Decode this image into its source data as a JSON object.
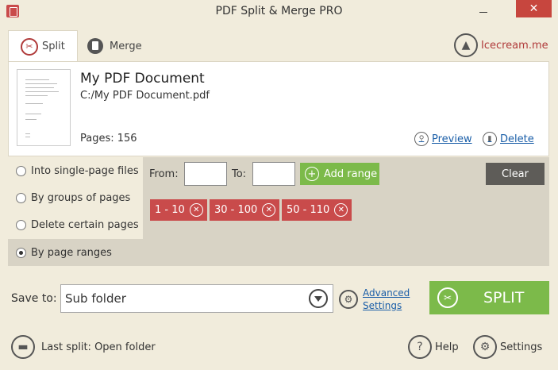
{
  "window": {
    "title": "PDF Split & Merge PRO",
    "close_glyph": "✕"
  },
  "tabs": {
    "split_label": "Split",
    "merge_label": "Merge"
  },
  "brand": {
    "text": "Icecream.me"
  },
  "document": {
    "name": "My PDF Document",
    "path": "C:/My PDF Document.pdf",
    "pages_text": "Pages: 156",
    "preview_label": "Preview",
    "delete_label": "Delete"
  },
  "options": {
    "items": [
      {
        "label": "Into single-page files",
        "checked": false
      },
      {
        "label": "By groups of pages",
        "checked": false
      },
      {
        "label": "Delete certain pages",
        "checked": false
      },
      {
        "label": "By page ranges",
        "checked": true
      }
    ]
  },
  "ranges": {
    "from_label": "From:",
    "from_value": "",
    "to_label": "To:",
    "to_value": "",
    "add_label": "Add range",
    "clear_label": "Clear",
    "chips": [
      "1 - 10",
      "30 - 100",
      "50 - 110"
    ]
  },
  "save": {
    "label": "Save to:",
    "selected": "Sub folder",
    "advanced_line1": "Advanced",
    "advanced_line2": "Settings",
    "split_label": "SPLIT"
  },
  "footer": {
    "last_split": "Last split: Open folder",
    "help_label": "Help",
    "settings_label": "Settings"
  },
  "colors": {
    "accent_green": "#7cba4a",
    "accent_red": "#c94b4b",
    "link_blue": "#1a5ea8",
    "background": "#f1ecdc"
  }
}
